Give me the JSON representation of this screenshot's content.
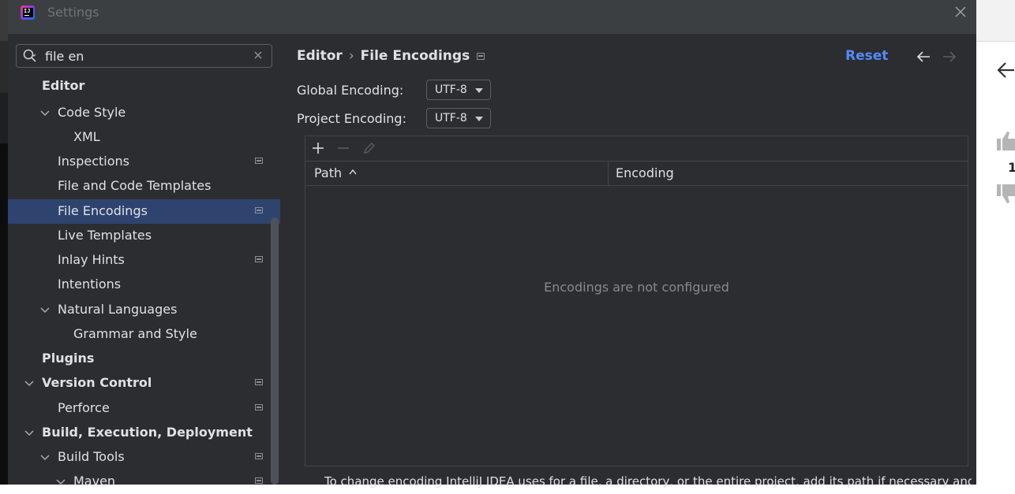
{
  "window": {
    "title": "Settings",
    "app_icon_text": "IJ"
  },
  "search": {
    "value": "file en",
    "placeholder": ""
  },
  "sidebar": {
    "items": [
      {
        "label": "Editor",
        "bold": true,
        "has_settings_icon": false
      },
      {
        "label": "Code Style",
        "expanded": true,
        "has_settings_icon": false
      },
      {
        "label": "XML",
        "has_settings_icon": false
      },
      {
        "label": "Inspections",
        "has_settings_icon": true
      },
      {
        "label": "File and Code Templates",
        "has_settings_icon": false
      },
      {
        "label": "File Encodings",
        "selected": true,
        "has_settings_icon": true
      },
      {
        "label": "Live Templates",
        "has_settings_icon": false
      },
      {
        "label": "Inlay Hints",
        "has_settings_icon": true
      },
      {
        "label": "Intentions",
        "has_settings_icon": false
      },
      {
        "label": "Natural Languages",
        "expanded": true,
        "has_settings_icon": false
      },
      {
        "label": "Grammar and Style",
        "has_settings_icon": false
      },
      {
        "label": "Plugins",
        "bold": true,
        "has_settings_icon": false
      },
      {
        "label": "Version Control",
        "bold": true,
        "expanded": true,
        "has_settings_icon": true
      },
      {
        "label": "Perforce",
        "has_settings_icon": true
      },
      {
        "label": "Build, Execution, Deployment",
        "bold": true,
        "expanded": true,
        "has_settings_icon": false
      },
      {
        "label": "Build Tools",
        "expanded": true,
        "has_settings_icon": true
      },
      {
        "label": "Maven",
        "expanded": true,
        "has_settings_icon": true
      }
    ]
  },
  "content": {
    "breadcrumb_parent": "Editor",
    "breadcrumb_separator": "›",
    "breadcrumb_current": "File Encodings",
    "reset_label": "Reset",
    "global_encoding_label": "Global Encoding:",
    "global_encoding_value": "UTF-8",
    "project_encoding_label": "Project Encoding:",
    "project_encoding_value": "UTF-8",
    "table": {
      "columns": [
        "Path",
        "Encoding"
      ],
      "sort_column": "Path",
      "sort_direction": "ascending",
      "empty_text": "Encodings are not configured"
    },
    "footer_text": "To change encoding IntelliJ IDEA uses for a file, a directory, or the entire project, add its path if necessary and then select"
  },
  "background": {
    "vote_count": "1"
  },
  "colors": {
    "dialog_bg": "#2b2d30",
    "titlebar_bg": "#3c3f41",
    "selection": "#2e436e",
    "link": "#548af7",
    "text": "#dfe1e5",
    "muted": "#868a91"
  },
  "icons": [
    "search-icon",
    "clear-icon",
    "close-icon",
    "chevron-down-icon",
    "settings-scope-icon",
    "back-arrow-icon",
    "forward-arrow-icon",
    "add-icon",
    "remove-icon",
    "edit-icon",
    "sort-ascending-icon",
    "thumbs-up-icon",
    "thumbs-down-icon"
  ]
}
